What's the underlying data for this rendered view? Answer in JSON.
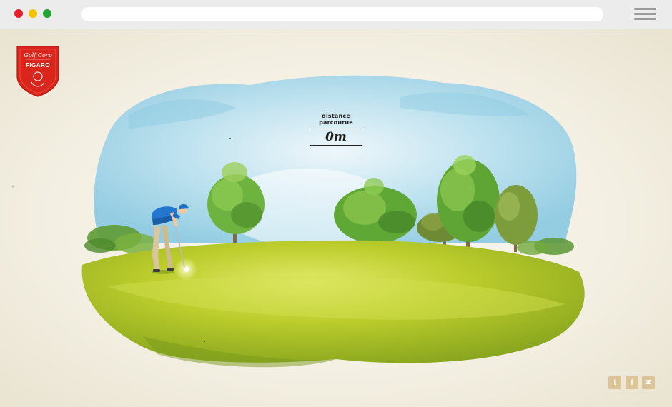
{
  "browser": {
    "window_controls": [
      "close",
      "minimize",
      "maximize"
    ],
    "menu_icon": "hamburger-icon"
  },
  "logo": {
    "top_text": "Golf Corp",
    "name": "FIGARO",
    "color": "#d9251c"
  },
  "distance": {
    "label": "distance parcourue",
    "value": "0m"
  },
  "social": {
    "icons": [
      "twitter-icon",
      "facebook-icon",
      "mail-icon"
    ],
    "twitter_glyph": "t",
    "facebook_glyph": "f",
    "mail_glyph": "✉",
    "color": "#dcc497"
  },
  "colors": {
    "sky": "#a9d8ea",
    "grass": "#b5c92a",
    "tree": "#5ea83a",
    "golfer_shirt": "#1f73c8",
    "background": "#f2efe3"
  }
}
